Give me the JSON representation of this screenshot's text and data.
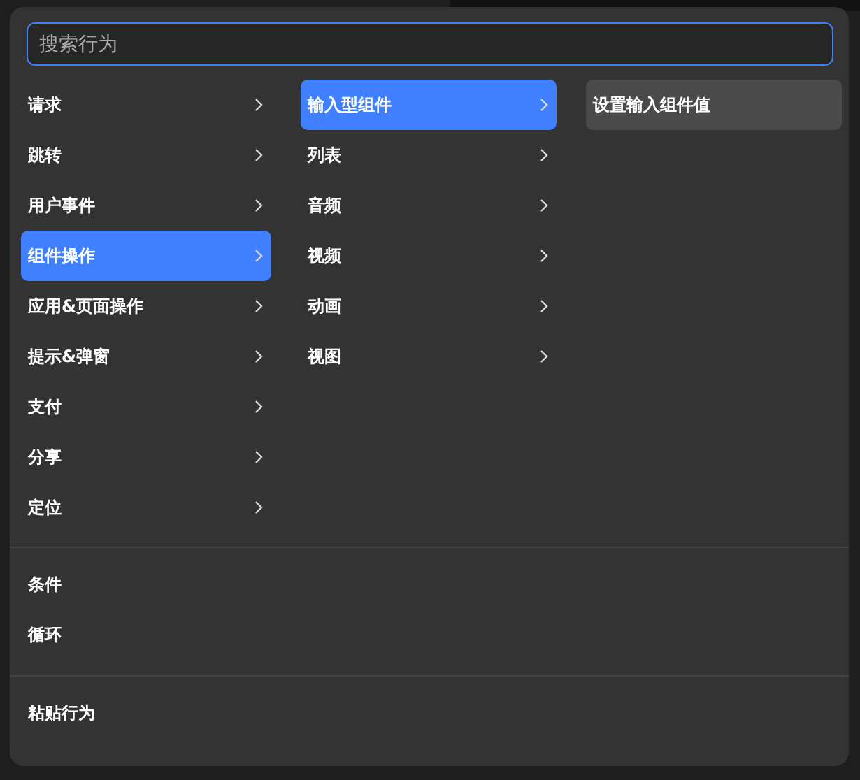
{
  "search": {
    "placeholder": "搜索行为"
  },
  "columns": [
    {
      "items": [
        {
          "label": "请求",
          "selected": false,
          "expandable": true
        },
        {
          "label": "跳转",
          "selected": false,
          "expandable": true
        },
        {
          "label": "用户事件",
          "selected": false,
          "expandable": true
        },
        {
          "label": "组件操作",
          "selected": true,
          "expandable": true
        },
        {
          "label": "应用&页面操作",
          "selected": false,
          "expandable": true
        },
        {
          "label": "提示&弹窗",
          "selected": false,
          "expandable": true
        },
        {
          "label": "支付",
          "selected": false,
          "expandable": true
        },
        {
          "label": "分享",
          "selected": false,
          "expandable": true
        },
        {
          "label": "定位",
          "selected": false,
          "expandable": true
        }
      ]
    },
    {
      "items": [
        {
          "label": "输入型组件",
          "selected": true,
          "expandable": true
        },
        {
          "label": "列表",
          "selected": false,
          "expandable": true
        },
        {
          "label": "音频",
          "selected": false,
          "expandable": true
        },
        {
          "label": "视频",
          "selected": false,
          "expandable": true
        },
        {
          "label": "动画",
          "selected": false,
          "expandable": true
        },
        {
          "label": "视图",
          "selected": false,
          "expandable": true
        }
      ]
    },
    {
      "items": [
        {
          "label": "设置输入组件值",
          "selected": true,
          "expandable": false
        }
      ]
    }
  ],
  "control_items": [
    {
      "label": "条件"
    },
    {
      "label": "循环"
    }
  ],
  "footer_items": [
    {
      "label": "粘贴行为"
    }
  ]
}
